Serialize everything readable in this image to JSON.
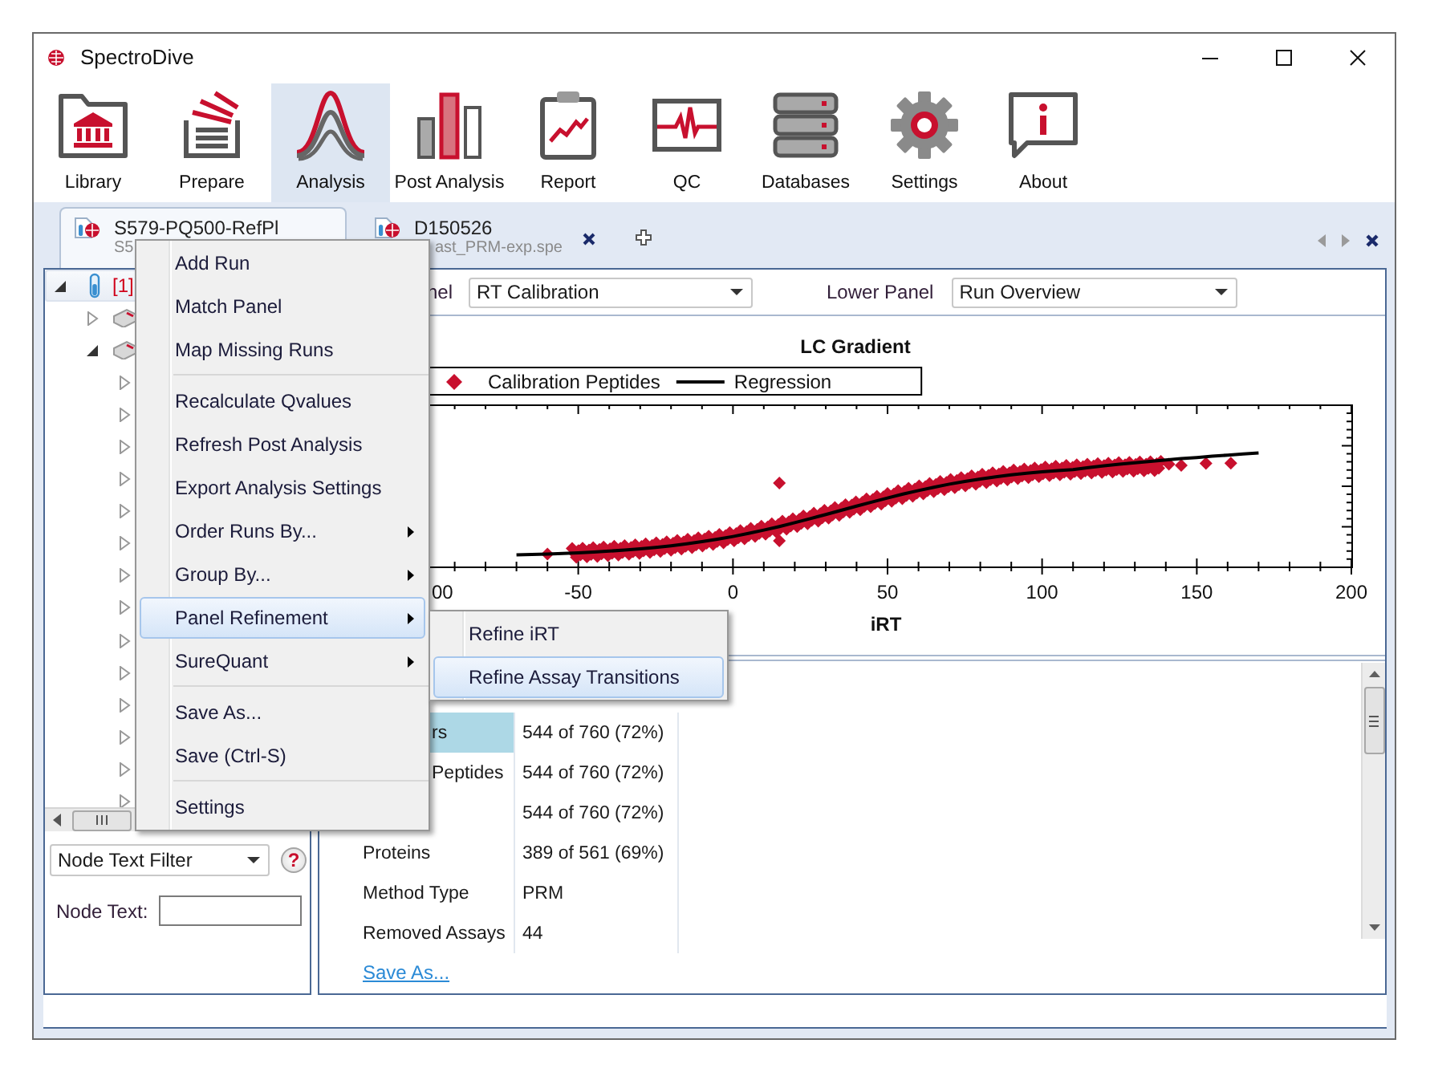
{
  "window": {
    "title": "SpectroDive"
  },
  "ribbon": [
    {
      "label": "Library",
      "selected": false
    },
    {
      "label": "Prepare",
      "selected": false
    },
    {
      "label": "Analysis",
      "selected": true
    },
    {
      "label": "Post Analysis",
      "selected": false
    },
    {
      "label": "Report",
      "selected": false
    },
    {
      "label": "QC",
      "selected": false
    },
    {
      "label": "Databases",
      "selected": false
    },
    {
      "label": "Settings",
      "selected": false
    },
    {
      "label": "About",
      "selected": false
    }
  ],
  "document_tabs": [
    {
      "title": "S579-PQ500-RefPl",
      "subtitle": "S5",
      "selected": true,
      "closable": false,
      "covered": false
    },
    {
      "title": "D150526",
      "subtitle": "ast_PRM-exp.spe",
      "selected": false,
      "closable": true,
      "covered": true
    }
  ],
  "tree": {
    "items": [
      {
        "label": "[1]",
        "selected": true,
        "expanded": true,
        "children": [
          {
            "selected": false,
            "expanded": false
          },
          {
            "selected": false,
            "expanded": true,
            "children": [
              {
                "selected": false,
                "expanded": false
              },
              {
                "selected": false,
                "expanded": false
              },
              {
                "selected": false,
                "expanded": false
              },
              {
                "selected": false,
                "expanded": false
              },
              {
                "selected": false,
                "expanded": false
              },
              {
                "selected": false,
                "expanded": false
              },
              {
                "selected": false,
                "expanded": false
              },
              {
                "selected": false,
                "expanded": false
              },
              {
                "selected": false,
                "expanded": false
              },
              {
                "selected": false,
                "expanded": false
              },
              {
                "selected": false,
                "expanded": false
              },
              {
                "selected": false,
                "expanded": false
              },
              {
                "selected": false,
                "expanded": false
              },
              {
                "selected": false,
                "expanded": false
              }
            ]
          }
        ]
      }
    ]
  },
  "node_filter": {
    "mode": "Node Text Filter",
    "help": "?",
    "label": "Node Text:"
  },
  "upper_panel": {
    "label": "nel",
    "value": "RT Calibration"
  },
  "lower_panel": {
    "label": "Lower Panel",
    "value": "Run Overview"
  },
  "chart": {
    "title": "LC Gradient",
    "legend": [
      {
        "kind": "marker",
        "label": "Calibration Peptides"
      },
      {
        "kind": "line",
        "label": "Regression"
      }
    ],
    "x_ticks": [
      {
        "label": "00",
        "covered": true
      },
      {
        "label": "-50",
        "covered": false
      },
      {
        "label": "0",
        "covered": false
      },
      {
        "label": "50",
        "covered": false
      },
      {
        "label": "100",
        "covered": false
      },
      {
        "label": "150",
        "covered": false
      },
      {
        "label": "200",
        "covered": false
      }
    ],
    "xlabel": "iRT"
  },
  "overview": {
    "rows": [
      {
        "label": "rs",
        "value": "544 of 760 (72%)",
        "selected": true,
        "covered": true
      },
      {
        "label": "Peptides",
        "value": "544 of 760 (72%)",
        "selected": false,
        "covered": true
      },
      {
        "value": "544 of 760 (72%)",
        "selected": false
      },
      {
        "label": "Proteins",
        "value": "389 of 561 (69%)",
        "selected": false,
        "covered": false
      },
      {
        "label": "Method Type",
        "value": "PRM",
        "selected": false,
        "covered": false
      },
      {
        "label": "Removed Assays",
        "value": "44",
        "selected": false,
        "covered": false
      }
    ],
    "link": "Save As..."
  },
  "context_menu": {
    "items": [
      {
        "kind": "item",
        "label": "Add Run",
        "highlighted": false,
        "submenu": false
      },
      {
        "kind": "item",
        "label": "Match Panel",
        "highlighted": false,
        "submenu": false
      },
      {
        "kind": "item",
        "label": "Map Missing Runs",
        "highlighted": false,
        "submenu": false
      },
      {
        "kind": "separator"
      },
      {
        "kind": "item",
        "label": "Recalculate Qvalues",
        "highlighted": false,
        "submenu": false
      },
      {
        "kind": "item",
        "label": "Refresh Post Analysis",
        "highlighted": false,
        "submenu": false
      },
      {
        "kind": "item",
        "label": "Export Analysis Settings",
        "highlighted": false,
        "submenu": false
      },
      {
        "kind": "item",
        "label": "Order Runs By...",
        "highlighted": false,
        "submenu": true
      },
      {
        "kind": "item",
        "label": "Group By...",
        "highlighted": false,
        "submenu": true
      },
      {
        "kind": "item",
        "label": "Panel Refinement",
        "highlighted": true,
        "submenu": true
      },
      {
        "kind": "item",
        "label": "SureQuant",
        "highlighted": false,
        "submenu": true
      },
      {
        "kind": "separator"
      },
      {
        "kind": "item",
        "label": "Save As...",
        "highlighted": false,
        "submenu": false
      },
      {
        "kind": "item",
        "label": "Save (Ctrl-S)",
        "highlighted": false,
        "submenu": false
      },
      {
        "kind": "separator"
      },
      {
        "kind": "item",
        "label": "Settings",
        "highlighted": false,
        "submenu": false
      }
    ]
  },
  "submenu": {
    "items": [
      {
        "kind": "item",
        "label": "Refine iRT",
        "highlighted": false,
        "submenu": false
      },
      {
        "kind": "item",
        "label": "Refine Assay Transitions",
        "highlighted": true,
        "submenu": false
      }
    ]
  }
}
